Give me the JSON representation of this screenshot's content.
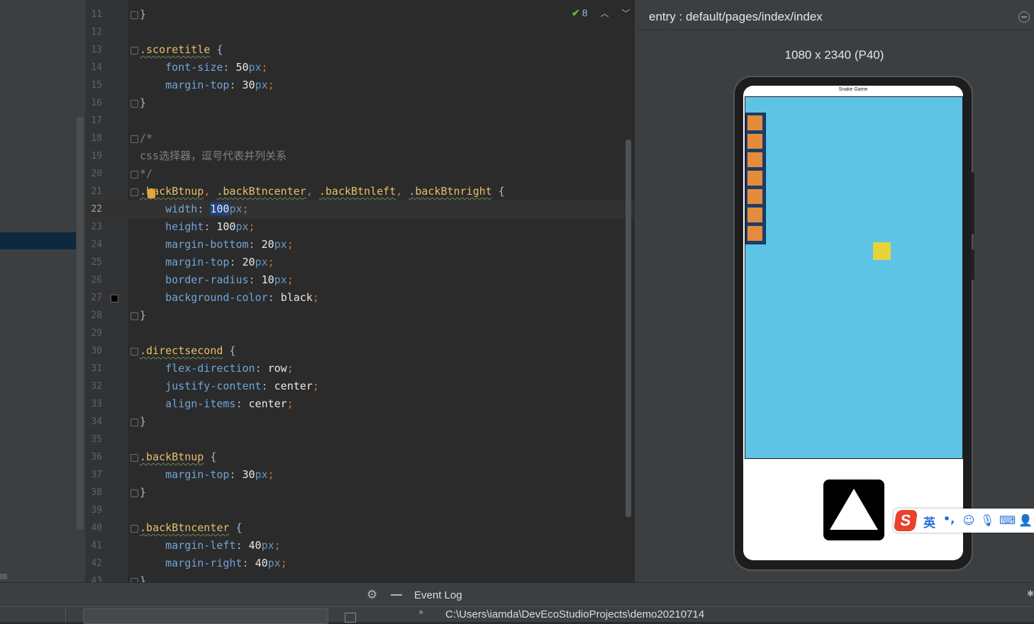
{
  "editor": {
    "lines": [
      {
        "n": "11",
        "html": "}"
      },
      {
        "n": "12",
        "html": ""
      },
      {
        "n": "13",
        "html": "<span class=\"sel-name wavy\">.scoretitle</span> {"
      },
      {
        "n": "14",
        "html": "    <span class=\"kw-prop\">font-size</span>: <span class=\"num\">50</span><span class=\"unit\">px</span><span class=\"punc\">;</span>"
      },
      {
        "n": "15",
        "html": "    <span class=\"kw-prop\">margin-top</span>: <span class=\"num\">30</span><span class=\"unit\">px</span><span class=\"punc\">;</span>"
      },
      {
        "n": "16",
        "html": "}"
      },
      {
        "n": "17",
        "html": ""
      },
      {
        "n": "18",
        "html": "<span class=\"cmt\">/*</span>"
      },
      {
        "n": "19",
        "html": "<span class=\"cmt\">css选择器，逗号代表并列关系</span>"
      },
      {
        "n": "20",
        "html": "<span class=\"cmt\">*/</span>"
      },
      {
        "n": "21",
        "html": "<span class=\"sel-name wavy\">.backBtnup</span><span class=\"punc\">,</span> <span class=\"sel-name wavy\">.backBtncenter</span><span class=\"punc\">,</span> <span class=\"sel-name wavy\">.backBtnleft</span><span class=\"punc\">,</span> <span class=\"sel-name wavy\">.backBtnright</span> {"
      },
      {
        "n": "22",
        "html": "    <span class=\"kw-prop\">width</span>: <span class=\"num hl\">100</span><span class=\"unit\">px</span><span class=\"punc\">;</span>",
        "current": true
      },
      {
        "n": "23",
        "html": "    <span class=\"kw-prop\">height</span>: <span class=\"num\">100</span><span class=\"unit\">px</span><span class=\"punc\">;</span>"
      },
      {
        "n": "24",
        "html": "    <span class=\"kw-prop\">margin-bottom</span>: <span class=\"num\">20</span><span class=\"unit\">px</span><span class=\"punc\">;</span>"
      },
      {
        "n": "25",
        "html": "    <span class=\"kw-prop\">margin-top</span>: <span class=\"num\">20</span><span class=\"unit\">px</span><span class=\"punc\">;</span>"
      },
      {
        "n": "26",
        "html": "    <span class=\"kw-prop\">border-radius</span>: <span class=\"num\">10</span><span class=\"unit\">px</span><span class=\"punc\">;</span>"
      },
      {
        "n": "27",
        "html": "    <span class=\"kw-prop\">background-color</span>: <span class=\"val\">black</span><span class=\"punc\">;</span>"
      },
      {
        "n": "28",
        "html": "}"
      },
      {
        "n": "29",
        "html": ""
      },
      {
        "n": "30",
        "html": "<span class=\"sel-name wavy\">.directsecond</span> {"
      },
      {
        "n": "31",
        "html": "    <span class=\"kw-prop\">flex-direction</span>: <span class=\"val\">row</span><span class=\"punc\">;</span>"
      },
      {
        "n": "32",
        "html": "    <span class=\"kw-prop\">justify-content</span>: <span class=\"val\">center</span><span class=\"punc\">;</span>"
      },
      {
        "n": "33",
        "html": "    <span class=\"kw-prop\">align-items</span>: <span class=\"val\">center</span><span class=\"punc\">;</span>"
      },
      {
        "n": "34",
        "html": "}"
      },
      {
        "n": "35",
        "html": ""
      },
      {
        "n": "36",
        "html": "<span class=\"sel-name wavy\">.backBtnup</span> {"
      },
      {
        "n": "37",
        "html": "    <span class=\"kw-prop\">margin-top</span>: <span class=\"num\">30</span><span class=\"unit\">px</span><span class=\"punc\">;</span>"
      },
      {
        "n": "38",
        "html": "}"
      },
      {
        "n": "39",
        "html": ""
      },
      {
        "n": "40",
        "html": "<span class=\"sel-name wavy\">.backBtncenter</span> {"
      },
      {
        "n": "41",
        "html": "    <span class=\"kw-prop\">margin-left</span>: <span class=\"num\">40</span><span class=\"unit\">px</span><span class=\"punc\">;</span>"
      },
      {
        "n": "42",
        "html": "    <span class=\"kw-prop\">margin-right</span>: <span class=\"num\">40</span><span class=\"unit\">px</span><span class=\"punc\">;</span>"
      },
      {
        "n": "43",
        "html": "}"
      }
    ],
    "fold_lines": [
      "11",
      "13",
      "16",
      "18",
      "20",
      "21",
      "28",
      "30",
      "34",
      "36",
      "38",
      "40",
      "43"
    ],
    "inspection_count": "8",
    "swatch_line": "27",
    "swatch_color": "#000000"
  },
  "preview": {
    "title": "entry : default/pages/index/index",
    "device": "1080 x 2340 (P40)",
    "app_title": "Snake Game",
    "snake_segments": 7,
    "board_color": "#5ec4e6",
    "snake_color": "#e58c3c",
    "food_color": "#e6d43a"
  },
  "ime": {
    "lang": "英",
    "punct": "•,",
    "icons": [
      "smiley-icon",
      "microphone-icon",
      "keyboard-icon",
      "user-icon"
    ]
  },
  "bottom": {
    "event_log": "Event Log",
    "path": "C:\\Users\\iamda\\DevEcoStudioProjects\\demo20210714",
    "chevron": "»"
  }
}
